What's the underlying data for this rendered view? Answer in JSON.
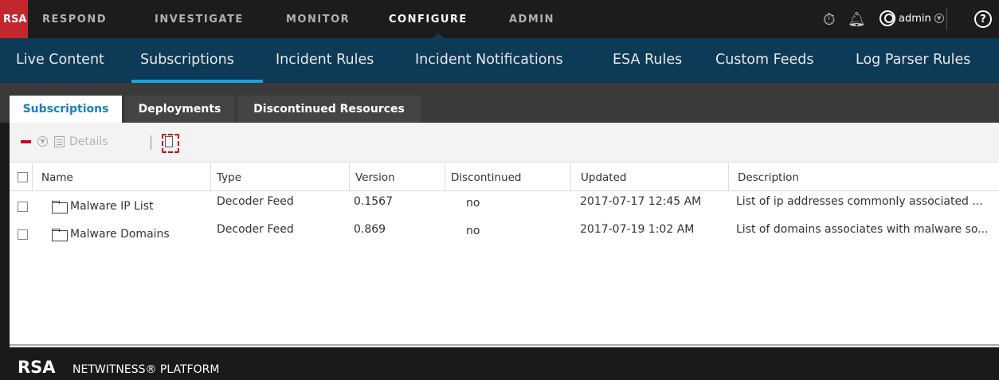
{
  "topnav": {
    "logo": "RSA",
    "items": [
      "RESPOND",
      "INVESTIGATE",
      "MONITOR",
      "CONFIGURE",
      "ADMIN"
    ],
    "active": "CONFIGURE",
    "user": "admin",
    "icons": [
      "stopwatch-icon",
      "bell-icon",
      "user-icon",
      "help-icon"
    ]
  },
  "subnav": {
    "items": [
      "Live Content",
      "Subscriptions",
      "Incident Rules",
      "Incident Notifications",
      "ESA Rules",
      "Custom Feeds",
      "Log Parser Rules"
    ],
    "active": "Subscriptions"
  },
  "tabs": {
    "items": [
      "Subscriptions",
      "Deployments",
      "Discontinued Resources"
    ],
    "active": "Subscriptions"
  },
  "toolbar": {
    "details_label": "Details"
  },
  "table": {
    "headers": [
      "Name",
      "Type",
      "Version",
      "Discontinued",
      "Updated",
      "Description"
    ],
    "rows": [
      {
        "name": "Malware IP List",
        "type": "Decoder Feed",
        "version": "0.1567",
        "discontinued": "no",
        "updated": "2017-07-17 12:45 AM",
        "description": "List of ip addresses commonly associated ..."
      },
      {
        "name": "Malware Domains",
        "type": "Decoder Feed",
        "version": "0.869",
        "discontinued": "no",
        "updated": "2017-07-19 1:02 AM",
        "description": "List of domains associates with malware so..."
      }
    ]
  },
  "footer": {
    "logo": "RSA",
    "product": "NETWITNESS® PLATFORM"
  },
  "colors": {
    "brand_red": "#c4262e",
    "subnav_bg": "#0c3a57",
    "active_underline": "#1fa3dd",
    "active_tab_text": "#1a7fc0"
  }
}
